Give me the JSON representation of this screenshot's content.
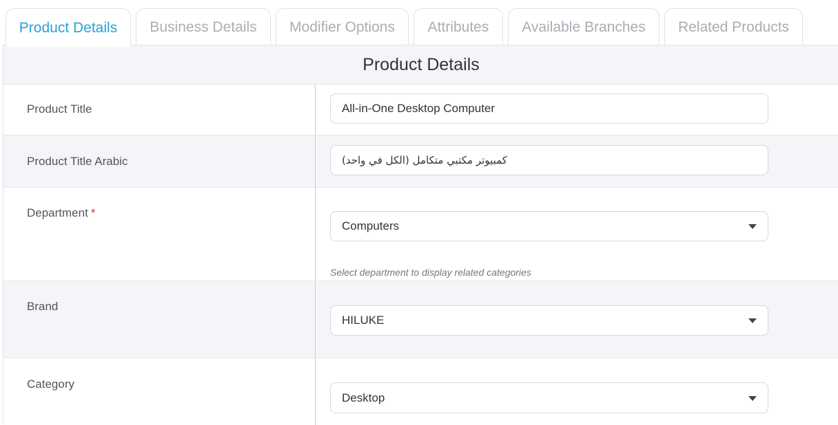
{
  "tabs": [
    {
      "label": "Product Details",
      "active": true
    },
    {
      "label": "Business Details",
      "active": false
    },
    {
      "label": "Modifier Options",
      "active": false
    },
    {
      "label": "Attributes",
      "active": false
    },
    {
      "label": "Available Branches",
      "active": false
    },
    {
      "label": "Related Products",
      "active": false
    }
  ],
  "panel": {
    "title": "Product Details"
  },
  "form": {
    "product_title": {
      "label": "Product Title",
      "value": "All-in-One Desktop Computer"
    },
    "product_title_arabic": {
      "label": "Product Title Arabic",
      "value": "كمبيوتر مكتبي متكامل (الكل في واحد)"
    },
    "department": {
      "label": "Department",
      "required_mark": "*",
      "value": "Computers",
      "help": "Select department to display related categories"
    },
    "brand": {
      "label": "Brand",
      "value": "HILUKE"
    },
    "category": {
      "label": "Category",
      "value": "Desktop"
    }
  },
  "colors": {
    "accent": "#2a9fd8",
    "required": "#d9362f",
    "row_alt": "#f4f5f8"
  },
  "icons": {
    "select_caret": "caret-down-icon"
  }
}
